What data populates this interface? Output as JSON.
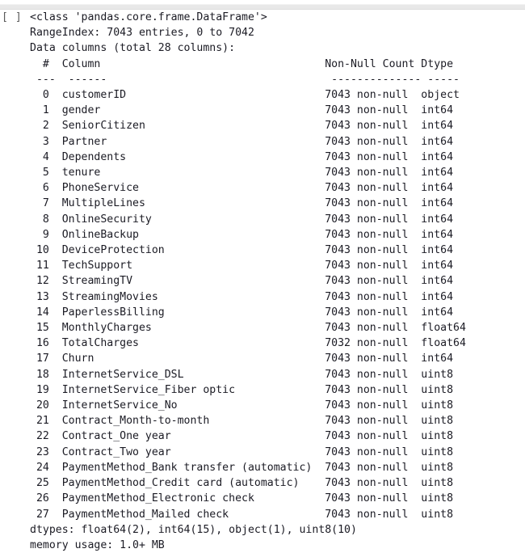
{
  "cell": {
    "execution_prompt": "[ ]",
    "prompt_color": "#5a5a5a",
    "background_color": "#ffffff",
    "text_color": "#1b1b24",
    "divider_color": "#e8e8e8"
  },
  "output": {
    "class_line": "<class 'pandas.core.frame.DataFrame'>",
    "range_index_line": "RangeIndex: 7043 entries, 0 to 7042",
    "data_columns_line": "Data columns (total 28 columns):",
    "header": {
      "index": "#",
      "column": "Column",
      "non_null_count": "Non-Null Count",
      "dtype": "Dtype"
    },
    "header_rule": {
      "index": "---",
      "column": "------",
      "non_null_count": "--------------",
      "dtype": "-----"
    },
    "columns": [
      {
        "index": "0",
        "name": "customerID",
        "non_null": "7043 non-null",
        "dtype": "object"
      },
      {
        "index": "1",
        "name": "gender",
        "non_null": "7043 non-null",
        "dtype": "int64"
      },
      {
        "index": "2",
        "name": "SeniorCitizen",
        "non_null": "7043 non-null",
        "dtype": "int64"
      },
      {
        "index": "3",
        "name": "Partner",
        "non_null": "7043 non-null",
        "dtype": "int64"
      },
      {
        "index": "4",
        "name": "Dependents",
        "non_null": "7043 non-null",
        "dtype": "int64"
      },
      {
        "index": "5",
        "name": "tenure",
        "non_null": "7043 non-null",
        "dtype": "int64"
      },
      {
        "index": "6",
        "name": "PhoneService",
        "non_null": "7043 non-null",
        "dtype": "int64"
      },
      {
        "index": "7",
        "name": "MultipleLines",
        "non_null": "7043 non-null",
        "dtype": "int64"
      },
      {
        "index": "8",
        "name": "OnlineSecurity",
        "non_null": "7043 non-null",
        "dtype": "int64"
      },
      {
        "index": "9",
        "name": "OnlineBackup",
        "non_null": "7043 non-null",
        "dtype": "int64"
      },
      {
        "index": "10",
        "name": "DeviceProtection",
        "non_null": "7043 non-null",
        "dtype": "int64"
      },
      {
        "index": "11",
        "name": "TechSupport",
        "non_null": "7043 non-null",
        "dtype": "int64"
      },
      {
        "index": "12",
        "name": "StreamingTV",
        "non_null": "7043 non-null",
        "dtype": "int64"
      },
      {
        "index": "13",
        "name": "StreamingMovies",
        "non_null": "7043 non-null",
        "dtype": "int64"
      },
      {
        "index": "14",
        "name": "PaperlessBilling",
        "non_null": "7043 non-null",
        "dtype": "int64"
      },
      {
        "index": "15",
        "name": "MonthlyCharges",
        "non_null": "7043 non-null",
        "dtype": "float64"
      },
      {
        "index": "16",
        "name": "TotalCharges",
        "non_null": "7032 non-null",
        "dtype": "float64"
      },
      {
        "index": "17",
        "name": "Churn",
        "non_null": "7043 non-null",
        "dtype": "int64"
      },
      {
        "index": "18",
        "name": "InternetService_DSL",
        "non_null": "7043 non-null",
        "dtype": "uint8"
      },
      {
        "index": "19",
        "name": "InternetService_Fiber optic",
        "non_null": "7043 non-null",
        "dtype": "uint8"
      },
      {
        "index": "20",
        "name": "InternetService_No",
        "non_null": "7043 non-null",
        "dtype": "uint8"
      },
      {
        "index": "21",
        "name": "Contract_Month-to-month",
        "non_null": "7043 non-null",
        "dtype": "uint8"
      },
      {
        "index": "22",
        "name": "Contract_One year",
        "non_null": "7043 non-null",
        "dtype": "uint8"
      },
      {
        "index": "23",
        "name": "Contract_Two year",
        "non_null": "7043 non-null",
        "dtype": "uint8"
      },
      {
        "index": "24",
        "name": "PaymentMethod_Bank transfer (automatic)",
        "non_null": "7043 non-null",
        "dtype": "uint8"
      },
      {
        "index": "25",
        "name": "PaymentMethod_Credit card (automatic)",
        "non_null": "7043 non-null",
        "dtype": "uint8"
      },
      {
        "index": "26",
        "name": "PaymentMethod_Electronic check",
        "non_null": "7043 non-null",
        "dtype": "uint8"
      },
      {
        "index": "27",
        "name": "PaymentMethod_Mailed check",
        "non_null": "7043 non-null",
        "dtype": "uint8"
      }
    ],
    "dtypes_line": "dtypes: float64(2), int64(15), object(1), uint8(10)",
    "memory_usage_line": "memory usage: 1.0+ MB"
  }
}
